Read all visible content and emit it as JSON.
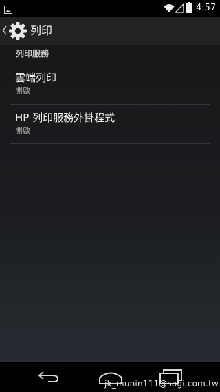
{
  "status_bar": {
    "time": "4:57",
    "icons": [
      "image-notification-icon",
      "wifi-icon",
      "cell-signal-icon",
      "battery-icon"
    ]
  },
  "action_bar": {
    "title": "列印",
    "icon": "gear-icon"
  },
  "section": {
    "header": "列印服務"
  },
  "services": [
    {
      "title": "雲端列印",
      "summary": "開啟"
    },
    {
      "title": "HP 列印服務外掛程式",
      "summary": "開啟"
    }
  ],
  "nav_bar": {
    "icons": [
      "back-icon",
      "home-icon",
      "recents-icon"
    ]
  },
  "watermark": "jk_munin111@sogi.com.tw",
  "colors": {
    "text_primary": "#f4f4f4",
    "text_secondary": "#a9a9a9",
    "header_text": "#c9c9c9",
    "action_bar_bg": "#212224"
  }
}
